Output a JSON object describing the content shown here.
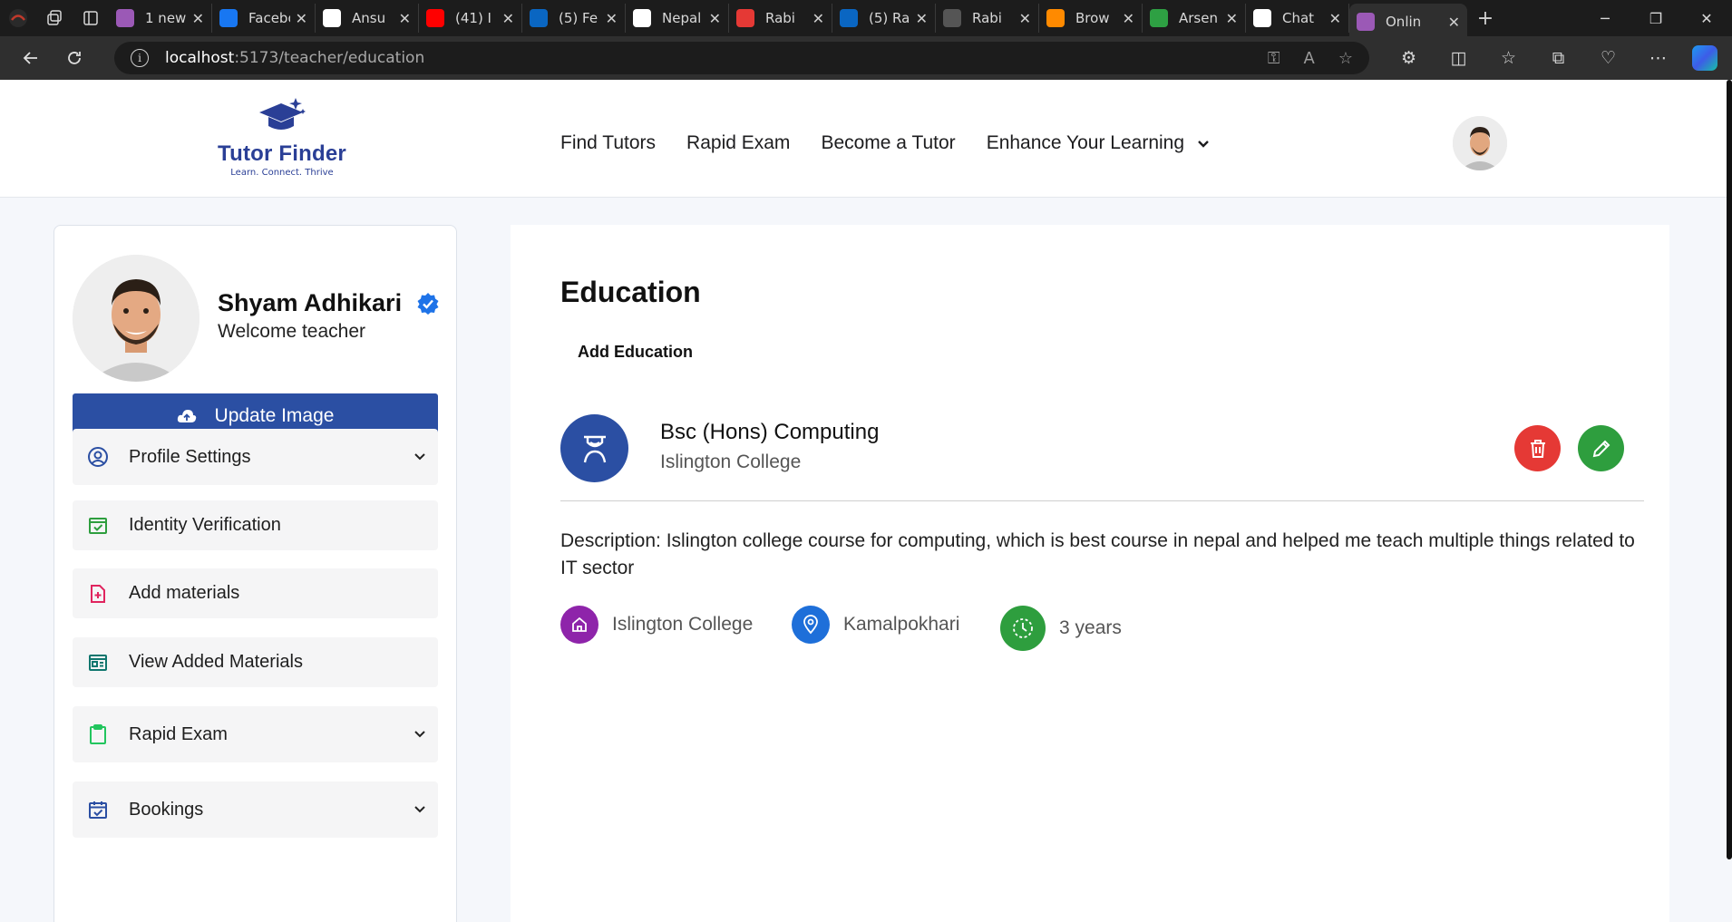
{
  "browser": {
    "tabs": [
      {
        "title": "1 new",
        "favicon": "vite-icon",
        "color": "#9b59b6"
      },
      {
        "title": "Facebook",
        "favicon": "facebook-icon",
        "color": "#1877f2"
      },
      {
        "title": "Ansu",
        "favicon": "app-icon",
        "color": "#ffffff"
      },
      {
        "title": "(41) I",
        "favicon": "youtube-icon",
        "color": "#ff0000"
      },
      {
        "title": "(5) Fe",
        "favicon": "linkedin-icon",
        "color": "#0a66c2"
      },
      {
        "title": "Nepal",
        "favicon": "github-icon",
        "color": "#ffffff"
      },
      {
        "title": "Rabi",
        "favicon": "pdf-icon",
        "color": "#e53935"
      },
      {
        "title": "(5) Ra",
        "favicon": "linkedin-icon",
        "color": "#0a66c2"
      },
      {
        "title": "Rabi",
        "favicon": "page-icon",
        "color": "#555555"
      },
      {
        "title": "Brow",
        "favicon": "brand-icon",
        "color": "#ff8a00"
      },
      {
        "title": "Arsen",
        "favicon": "brand-icon",
        "color": "#2ea043"
      },
      {
        "title": "Chat",
        "favicon": "chatgpt-icon",
        "color": "#ffffff"
      },
      {
        "title": "Onlin",
        "favicon": "vite-icon",
        "color": "#9b59b6",
        "active": true
      }
    ],
    "address": {
      "host": "localhost",
      "path": ":5173/teacher/education"
    }
  },
  "site": {
    "logo_name": "Tutor Finder",
    "logo_tagline": "Learn. Connect. Thrive",
    "nav": [
      "Find Tutors",
      "Rapid Exam",
      "Become a Tutor",
      "Enhance Your Learning"
    ]
  },
  "profile": {
    "name": "Shyam Adhikari",
    "subtitle": "Welcome teacher",
    "update_image_label": "Update Image"
  },
  "sidebar": {
    "items": [
      {
        "label": "Profile Settings",
        "icon": "user-circle-icon",
        "color": "#2b4fa3",
        "has_dropdown": true
      },
      {
        "label": "Identity Verification",
        "icon": "check-square-icon",
        "color": "#2e9e3e",
        "has_dropdown": false
      },
      {
        "label": "Add materials",
        "icon": "file-plus-icon",
        "color": "#e0245e",
        "has_dropdown": false
      },
      {
        "label": "View Added Materials",
        "icon": "newspaper-icon",
        "color": "#0f766e",
        "has_dropdown": false
      },
      {
        "label": "Rapid Exam",
        "icon": "clipboard-icon",
        "color": "#22c55e",
        "has_dropdown": true
      },
      {
        "label": "Bookings",
        "icon": "calendar-check-icon",
        "color": "#2b4fa3",
        "has_dropdown": true
      }
    ]
  },
  "main": {
    "title": "Education",
    "add_label": "Add Education",
    "education": {
      "degree": "Bsc (Hons) Computing",
      "institution": "Islington College",
      "description": "Description: Islington college course for computing, which is best course in nepal and helped me teach multiple things related to IT sector",
      "meta": [
        {
          "icon": "home-icon",
          "text": "Islington College",
          "color": "#8e24aa"
        },
        {
          "icon": "map-pin-icon",
          "text": "Kamalpokhari",
          "color": "#1e6fd9"
        },
        {
          "icon": "clock-icon",
          "text": "3 years",
          "color": "#2e9e3e"
        }
      ]
    }
  },
  "colors": {
    "primary": "#2b4fa3",
    "danger": "#e53935",
    "success": "#2e9e3e"
  }
}
